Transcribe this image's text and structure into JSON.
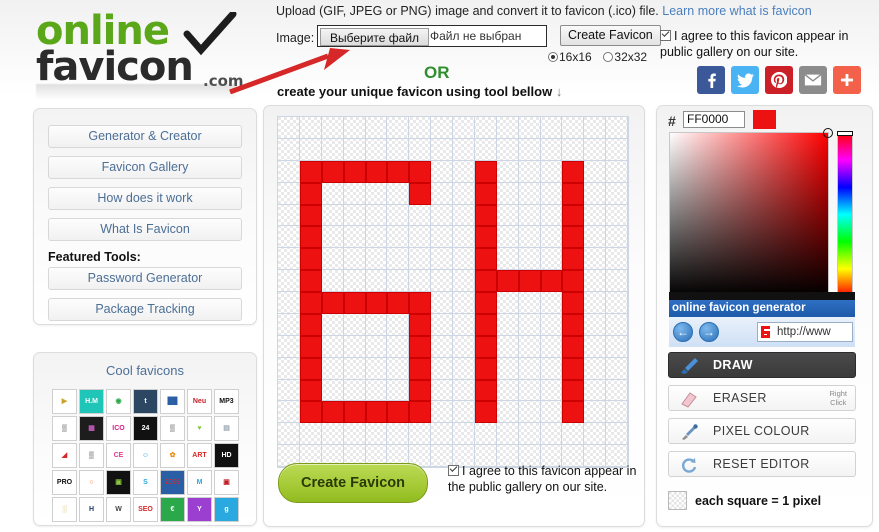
{
  "logo": {
    "line1": "online",
    "line2": "favicon",
    "suffix": ".com",
    "check_icon": "check-mark-icon"
  },
  "header": {
    "upload_text": "Upload (GIF, JPEG or PNG) image and convert it to favicon (.ico) file.",
    "learn_more": "Learn more what is favicon",
    "image_label": "Image:",
    "file_button": "Выберите файл",
    "file_status": "Файл не выбран",
    "create_favicon_button": "Create Favicon",
    "size_16": "16x16",
    "size_32": "32x32",
    "size_selected": "16x16",
    "agree_text": "I agree to this favicon appear in public gallery on our site.",
    "agree_checked": true
  },
  "social": {
    "items": [
      {
        "name": "facebook-share-button",
        "glyph": "f",
        "color": "#3b5998"
      },
      {
        "name": "twitter-share-button",
        "glyph": "ᵗ",
        "color": "#4ab3f4"
      },
      {
        "name": "pinterest-share-button",
        "glyph": "ᵖ",
        "color": "#cb2027"
      },
      {
        "name": "email-share-button",
        "glyph": "✉",
        "color": "#8c8c8c"
      },
      {
        "name": "more-share-button",
        "glyph": "+",
        "color": "#f4614a"
      }
    ]
  },
  "or_block": {
    "or": "OR",
    "subtitle": "create your unique favicon using tool bellow",
    "down_arrow": "↓"
  },
  "sidebar": {
    "menu": [
      {
        "label": "Generator & Creator"
      },
      {
        "label": "Favicon Gallery"
      },
      {
        "label": "How does it work"
      },
      {
        "label": "What Is Favicon"
      }
    ],
    "featured_label": "Featured Tools:",
    "featured": [
      {
        "label": "Password Generator"
      },
      {
        "label": "Package Tracking"
      }
    ]
  },
  "cool_favicons": {
    "title": "Cool favicons",
    "items": [
      {
        "text": "▶",
        "fg": "#c9a227",
        "bg": "#ffffff"
      },
      {
        "text": "H.M",
        "fg": "#ffffff",
        "bg": "#1fc6b8"
      },
      {
        "text": "◉",
        "fg": "#2aa84a",
        "bg": "#ffffff"
      },
      {
        "text": "t",
        "fg": "#ffffff",
        "bg": "#2c4762"
      },
      {
        "text": "██",
        "fg": "#2a5fa5",
        "bg": "#ffffff"
      },
      {
        "text": "Neu",
        "fg": "#c02026",
        "bg": "#ffffff"
      },
      {
        "text": "MP3",
        "fg": "#111111",
        "bg": "#ffffff"
      },
      {
        "text": "▒",
        "fg": "#111111",
        "bg": "#ffffff"
      },
      {
        "text": "▦",
        "fg": "#c35bbd",
        "bg": "#1d1d1d"
      },
      {
        "text": "ICO",
        "fg": "#d61f8c",
        "bg": "#ffffff"
      },
      {
        "text": "24",
        "fg": "#ffffff",
        "bg": "#111111"
      },
      {
        "text": "▒",
        "fg": "#111111",
        "bg": "#ffffff"
      },
      {
        "text": "♥",
        "fg": "#8dc63f",
        "bg": "#ffffff"
      },
      {
        "text": "▤",
        "fg": "#9aa5b1",
        "bg": "#ffffff"
      },
      {
        "text": "◢",
        "fg": "#d62828",
        "bg": "#ffffff"
      },
      {
        "text": "▒",
        "fg": "#111111",
        "bg": "#ffffff"
      },
      {
        "text": "CE",
        "fg": "#e23b8c",
        "bg": "#ffffff"
      },
      {
        "text": "☺",
        "fg": "#2aa9e0",
        "bg": "#ffffff"
      },
      {
        "text": "✿",
        "fg": "#f0880a",
        "bg": "#ffffff"
      },
      {
        "text": "ART",
        "fg": "#d62828",
        "bg": "#ffffff"
      },
      {
        "text": "HD",
        "fg": "#ffffff",
        "bg": "#111111"
      },
      {
        "text": "PRO",
        "fg": "#111111",
        "bg": "#ffffff"
      },
      {
        "text": "○",
        "fg": "#f07020",
        "bg": "#ffffff"
      },
      {
        "text": "▣",
        "fg": "#8dc63f",
        "bg": "#111111"
      },
      {
        "text": "S",
        "fg": "#2aa9e0",
        "bg": "#ffffff"
      },
      {
        "text": "2099",
        "fg": "#d62828",
        "bg": "#2a5fa5"
      },
      {
        "text": "M",
        "fg": "#2aa9e0",
        "bg": "#ffffff"
      },
      {
        "text": "▣",
        "fg": "#c02026",
        "bg": "#ffffff"
      },
      {
        "text": "░",
        "fg": "#c9a227",
        "bg": "#ffffff"
      },
      {
        "text": "H",
        "fg": "#1a3a6b",
        "bg": "#ffffff"
      },
      {
        "text": "W",
        "fg": "#444444",
        "bg": "#ffffff"
      },
      {
        "text": "SEO",
        "fg": "#d62828",
        "bg": "#ffffff"
      },
      {
        "text": "€",
        "fg": "#ffffff",
        "bg": "#2aa84a"
      },
      {
        "text": "Y",
        "fg": "#ffffff",
        "bg": "#9b3fd0"
      },
      {
        "text": "g",
        "fg": "#ffffff",
        "bg": "#2aa9e0"
      }
    ]
  },
  "editor": {
    "grid_size": 16,
    "pixel_color": "#ee1111",
    "create_favicon_button": "Create Favicon",
    "agree_text": "I agree to this favicon appear in the public gallery on our site.",
    "agree_checked": true,
    "pixels": [
      [
        0,
        0,
        0,
        0,
        0,
        0,
        0,
        0,
        0,
        0,
        0,
        0,
        0,
        0,
        0,
        0
      ],
      [
        0,
        0,
        0,
        0,
        0,
        0,
        0,
        0,
        0,
        0,
        0,
        0,
        0,
        0,
        0,
        0
      ],
      [
        0,
        1,
        1,
        1,
        1,
        1,
        1,
        0,
        0,
        1,
        0,
        0,
        0,
        1,
        0,
        0
      ],
      [
        0,
        1,
        0,
        0,
        0,
        0,
        1,
        0,
        0,
        1,
        0,
        0,
        0,
        1,
        0,
        0
      ],
      [
        0,
        1,
        0,
        0,
        0,
        0,
        0,
        0,
        0,
        1,
        0,
        0,
        0,
        1,
        0,
        0
      ],
      [
        0,
        1,
        0,
        0,
        0,
        0,
        0,
        0,
        0,
        1,
        0,
        0,
        0,
        1,
        0,
        0
      ],
      [
        0,
        1,
        0,
        0,
        0,
        0,
        0,
        0,
        0,
        1,
        0,
        0,
        0,
        1,
        0,
        0
      ],
      [
        0,
        1,
        0,
        0,
        0,
        0,
        0,
        0,
        0,
        1,
        1,
        1,
        1,
        1,
        0,
        0
      ],
      [
        0,
        1,
        1,
        1,
        1,
        1,
        1,
        0,
        0,
        1,
        0,
        0,
        0,
        1,
        0,
        0
      ],
      [
        0,
        1,
        0,
        0,
        0,
        0,
        1,
        0,
        0,
        1,
        0,
        0,
        0,
        1,
        0,
        0
      ],
      [
        0,
        1,
        0,
        0,
        0,
        0,
        1,
        0,
        0,
        1,
        0,
        0,
        0,
        1,
        0,
        0
      ],
      [
        0,
        1,
        0,
        0,
        0,
        0,
        1,
        0,
        0,
        1,
        0,
        0,
        0,
        1,
        0,
        0
      ],
      [
        0,
        1,
        0,
        0,
        0,
        0,
        1,
        0,
        0,
        1,
        0,
        0,
        0,
        1,
        0,
        0
      ],
      [
        0,
        1,
        1,
        1,
        1,
        1,
        1,
        0,
        0,
        1,
        0,
        0,
        0,
        1,
        0,
        0
      ],
      [
        0,
        0,
        0,
        0,
        0,
        0,
        0,
        0,
        0,
        0,
        0,
        0,
        0,
        0,
        0,
        0
      ],
      [
        0,
        0,
        0,
        0,
        0,
        0,
        0,
        0,
        0,
        0,
        0,
        0,
        0,
        0,
        0,
        0
      ]
    ]
  },
  "color_picker": {
    "hash": "#",
    "hex_value": "FF0000",
    "swatch_color": "#ee1111",
    "selected_hue": "#ff0000"
  },
  "preview": {
    "title": "online favicon generator",
    "back_icon": "back-arrow-icon",
    "forward_icon": "forward-arrow-icon",
    "url_text": "http://www"
  },
  "tools": [
    {
      "label": "DRAW",
      "icon": "brush-icon",
      "active": true,
      "hint": ""
    },
    {
      "label": "ERASER",
      "icon": "eraser-icon",
      "active": false,
      "hint": "Right\nClick"
    },
    {
      "label": "PIXEL COLOUR",
      "icon": "eyedropper-icon",
      "active": false,
      "hint": ""
    },
    {
      "label": "RESET EDITOR",
      "icon": "refresh-icon",
      "active": false,
      "hint": ""
    }
  ],
  "legend": {
    "text": "each square = 1 pixel",
    "icon": "checker-square-icon"
  }
}
